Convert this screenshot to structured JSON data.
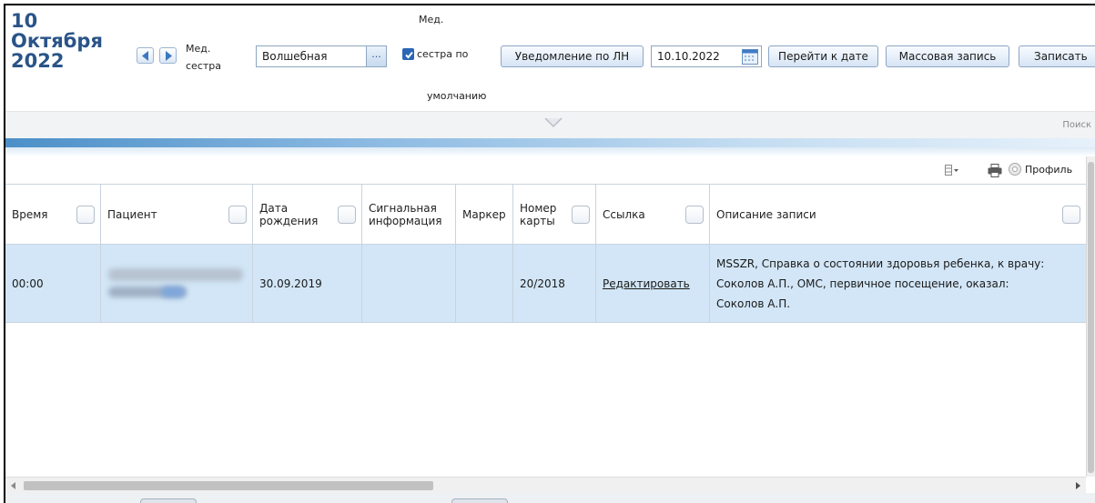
{
  "header": {
    "date_day": "10",
    "date_month": "Октября",
    "date_year": "2022",
    "nurse_label_line1": "Мед.",
    "nurse_label_line2": "сестра",
    "nurse_value": "Волшебная",
    "nurse_picker_label": "...",
    "default_nurse_top": "Мед.",
    "default_nurse_line1": "сестра по",
    "default_nurse_line2": "умолчанию",
    "default_nurse_checked": true,
    "notify_button": "Уведомление по ЛН",
    "date_value": "10.10.2022",
    "goto_button": "Перейти к дате",
    "mass_button": "Массовая запись",
    "record_button": "Записать"
  },
  "collapse": {
    "search_label": "Поиск"
  },
  "grid_toolbar": {
    "profile_label": "Профиль"
  },
  "grid": {
    "columns": [
      {
        "line1": "Время",
        "line2": "",
        "has_checkbox": true
      },
      {
        "line1": "Пациент",
        "line2": "",
        "has_checkbox": true
      },
      {
        "line1": "Дата",
        "line2": "рождения",
        "has_checkbox": true
      },
      {
        "line1": "Сигнальная",
        "line2": "информация",
        "has_checkbox": false
      },
      {
        "line1": "Маркер",
        "line2": "",
        "has_checkbox": false
      },
      {
        "line1": "Номер",
        "line2": "карты",
        "has_checkbox": true
      },
      {
        "line1": "Ссылка",
        "line2": "",
        "has_checkbox": true
      },
      {
        "line1": "Описание записи",
        "line2": "",
        "has_checkbox": true
      }
    ],
    "rows": [
      {
        "time": "00:00",
        "birth_date": "30.09.2019",
        "signal_info": "",
        "marker": "",
        "card_number": "20/2018",
        "link_label": "Редактировать",
        "description_line1": "MSSZR, Справка о состоянии здоровья ребенка, к врачу:",
        "description_line2": "Соколов А.П., ОМС, первичное посещение, оказал:",
        "description_line3": "Соколов А.П."
      }
    ]
  },
  "icons": {
    "prev": "arrow-left-icon",
    "next": "arrow-right-icon",
    "calendar": "calendar-icon",
    "collapse": "chevron-down-icon",
    "columns": "columns-menu-icon",
    "print": "printer-icon",
    "profile": "gear-icon"
  },
  "colors": {
    "date_text": "#2a5488",
    "selected_row": "#d2e6f7",
    "accent_strip": "#4c8fc8"
  }
}
